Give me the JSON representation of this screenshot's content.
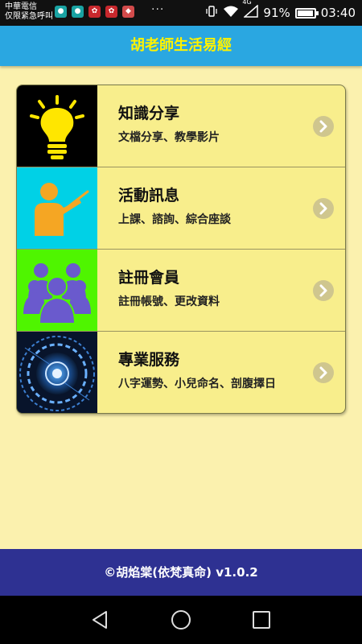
{
  "status_bar": {
    "carrier_line1": "中華電信",
    "carrier_line2": "仅限紧急呼叫",
    "network": "4G",
    "battery_percent": "91%",
    "time": "03:40",
    "notification_icons": [
      {
        "name": "app-icon-1",
        "color": "#1aa3a3"
      },
      {
        "name": "app-icon-2",
        "color": "#1aa3a3"
      },
      {
        "name": "huawei-icon",
        "color": "#c8282d"
      },
      {
        "name": "huawei-icon",
        "color": "#c8282d"
      },
      {
        "name": "app-icon-5",
        "color": "#d24b4b"
      }
    ]
  },
  "app": {
    "title": "胡老師生活易經"
  },
  "menu": {
    "items": [
      {
        "title": "知識分享",
        "subtitle": "文檔分享、教學影片",
        "icon": "lightbulb-icon",
        "bg": "#000000"
      },
      {
        "title": "活動訊息",
        "subtitle": "上課、諮詢、綜合座談",
        "icon": "teacher-icon",
        "bg": "#00d1e6"
      },
      {
        "title": "註冊會員",
        "subtitle": "註冊帳號、更改資料",
        "icon": "people-icon",
        "bg": "#4ff500"
      },
      {
        "title": "專業服務",
        "subtitle": "八字運勢、小兒命名、剖腹擇日",
        "icon": "compass-icon",
        "bg": "#0a1a33"
      }
    ]
  },
  "footer": {
    "text": "©胡焰棠(依梵真命) v1.0.2"
  },
  "colors": {
    "appbar": "#2aa7e1",
    "title": "#fff200",
    "background": "#fbf1ae",
    "card": "#f8ee8c",
    "footer": "#2e3192"
  }
}
